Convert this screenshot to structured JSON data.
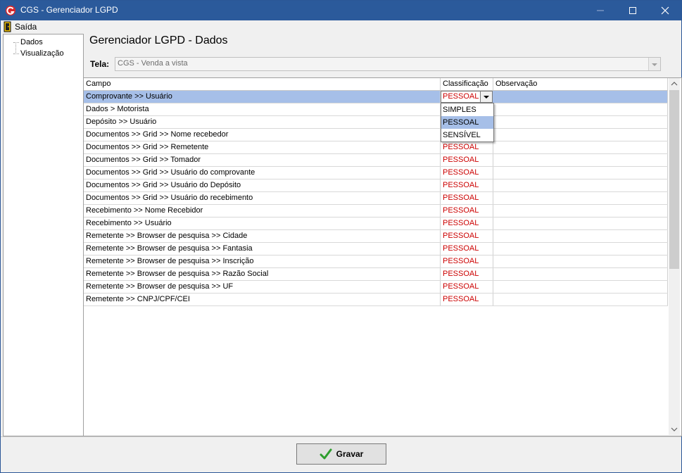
{
  "window": {
    "title": "CGS - Gerenciador LGPD"
  },
  "menu": {
    "exit_label": "Saída"
  },
  "tree": {
    "items": [
      "Dados",
      "Visualização"
    ]
  },
  "main": {
    "title": "Gerenciador LGPD - Dados",
    "tela_label": "Tela:",
    "tela_value": "CGS - Venda a vista"
  },
  "grid": {
    "headers": {
      "campo": "Campo",
      "classificacao": "Classificação",
      "observacao": "Observação"
    },
    "rows": [
      {
        "campo": "Comprovante >> Usuário",
        "classificacao": "PESSOAL",
        "observacao": ""
      },
      {
        "campo": "Dados > Motorista",
        "classificacao": "",
        "observacao": ""
      },
      {
        "campo": "Depósito >> Usuário",
        "classificacao": "",
        "observacao": ""
      },
      {
        "campo": "Documentos >> Grid >> Nome recebedor",
        "classificacao": "",
        "observacao": ""
      },
      {
        "campo": "Documentos >> Grid >> Remetente",
        "classificacao": "PESSOAL",
        "observacao": ""
      },
      {
        "campo": "Documentos >> Grid >> Tomador",
        "classificacao": "PESSOAL",
        "observacao": ""
      },
      {
        "campo": "Documentos >> Grid >> Usuário do comprovante",
        "classificacao": "PESSOAL",
        "observacao": ""
      },
      {
        "campo": "Documentos >> Grid >> Usuário do Depósito",
        "classificacao": "PESSOAL",
        "observacao": ""
      },
      {
        "campo": "Documentos >> Grid >> Usuário do recebimento",
        "classificacao": "PESSOAL",
        "observacao": ""
      },
      {
        "campo": "Recebimento >> Nome Recebidor",
        "classificacao": "PESSOAL",
        "observacao": ""
      },
      {
        "campo": "Recebimento >> Usuário",
        "classificacao": "PESSOAL",
        "observacao": ""
      },
      {
        "campo": "Remetente >> Browser de pesquisa >> Cidade",
        "classificacao": "PESSOAL",
        "observacao": ""
      },
      {
        "campo": "Remetente >> Browser de pesquisa >> Fantasia",
        "classificacao": "PESSOAL",
        "observacao": ""
      },
      {
        "campo": "Remetente >> Browser de pesquisa >> Inscrição",
        "classificacao": "PESSOAL",
        "observacao": ""
      },
      {
        "campo": "Remetente >> Browser de pesquisa >> Razão Social",
        "classificacao": "PESSOAL",
        "observacao": ""
      },
      {
        "campo": "Remetente >> Browser de pesquisa >> UF",
        "classificacao": "PESSOAL",
        "observacao": ""
      },
      {
        "campo": "Remetente >> CNPJ/CPF/CEI",
        "classificacao": "PESSOAL",
        "observacao": ""
      }
    ],
    "dropdown_options": [
      "SIMPLES",
      "PESSOAL",
      "SENSÍVEL"
    ],
    "dropdown_highlighted": "PESSOAL"
  },
  "footer": {
    "save_label": "Gravar"
  },
  "colors": {
    "titlebar": "#2b5a9b",
    "selection": "#a6bfe8",
    "classification_text": "#cc0000",
    "save_check": "#2e9e2e"
  }
}
